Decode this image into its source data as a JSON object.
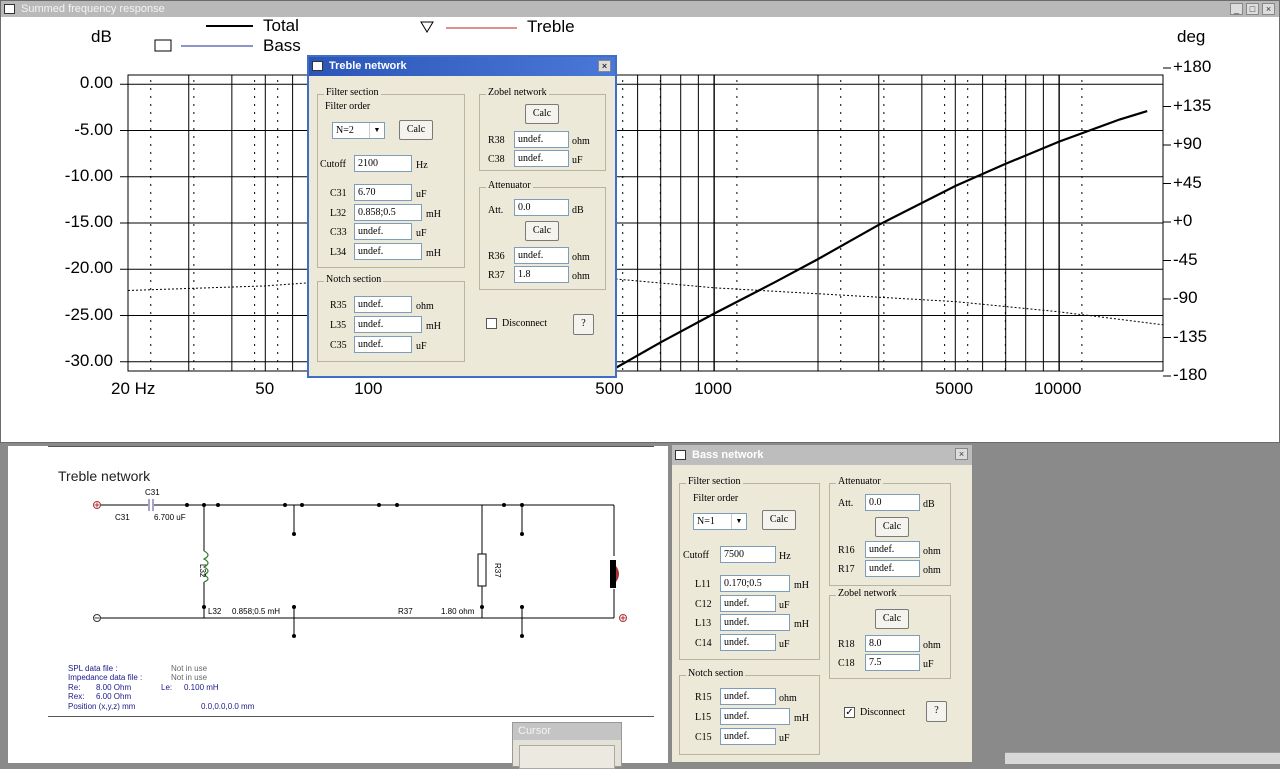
{
  "freq_window": {
    "title": "Summed frequency response",
    "legend": {
      "total": "Total",
      "bass": "Bass",
      "treble": "Treble"
    },
    "y_left_unit": "dB",
    "y_right_unit": "deg",
    "y_left_ticks": [
      "0.00",
      "-5.00",
      "-10.00",
      "-15.00",
      "-20.00",
      "-25.00",
      "-30.00"
    ],
    "y_right_ticks": [
      "+180",
      "+135",
      "+90",
      "+45",
      "+0",
      "-45",
      "-90",
      "-135",
      "-180"
    ],
    "x_ticks": [
      "20 Hz",
      "50",
      "100",
      "500",
      "1000",
      "5000",
      "10000"
    ]
  },
  "chart_data": {
    "type": "line",
    "title": "Summed frequency response",
    "xlabel": "",
    "ylabel": "dB",
    "y2label": "deg",
    "x_scale": "log",
    "xlim": [
      20,
      20000
    ],
    "ylim": [
      -31,
      1
    ],
    "y2lim": [
      -180,
      180
    ],
    "grid": true,
    "legend_position": "top",
    "series": [
      {
        "name": "Total",
        "style": "solid",
        "color": "#000000",
        "x": [
          500,
          700,
          1000,
          1500,
          2000,
          3000,
          5000,
          7000,
          10000,
          15000,
          18000
        ],
        "y": [
          -31.0,
          -27.9,
          -24.8,
          -21.4,
          -18.9,
          -15.2,
          -11.0,
          -8.6,
          -6.2,
          -3.8,
          -2.9
        ]
      },
      {
        "name": "Treble",
        "style": "dotted",
        "color": "#000000",
        "x": [
          20,
          50,
          100,
          500,
          1000,
          5000,
          10000,
          20000
        ],
        "y": [
          -22.3,
          -21.8,
          -21.0,
          -21.0,
          -22.0,
          -23.5,
          -24.6,
          -26.0
        ]
      }
    ]
  },
  "treble_dialog": {
    "title": "Treble network",
    "filter_section": "Filter section",
    "filter_order_label": "Filter order",
    "filter_order_value": "N=2",
    "calc": "Calc",
    "cutoff_label": "Cutoff",
    "cutoff_value": "2100",
    "cutoff_unit": "Hz",
    "c31_label": "C31",
    "c31_value": "6.70",
    "c31_unit": "uF",
    "l32_label": "L32",
    "l32_value": "0.858;0.5",
    "l32_unit": "mH",
    "c33_label": "C33",
    "c33_value": "undef.",
    "c33_unit": "uF",
    "l34_label": "L34",
    "l34_value": "undef.",
    "l34_unit": "mH",
    "notch_section": "Notch section",
    "r35_label": "R35",
    "r35_value": "undef.",
    "r35_unit": "ohm",
    "l35_label": "L35",
    "l35_value": "undef.",
    "l35_unit": "mH",
    "c35_label": "C35",
    "c35_value": "undef.",
    "c35_unit": "uF",
    "zobel_section": "Zobel network",
    "r38_label": "R38",
    "r38_value": "undef.",
    "r38_unit": "ohm",
    "c38_label": "C38",
    "c38_value": "undef.",
    "c38_unit": "uF",
    "att_section": "Attenuator",
    "att_label": "Att.",
    "att_value": "0.0",
    "att_unit": "dB",
    "r36_label": "R36",
    "r36_value": "undef.",
    "r36_unit": "ohm",
    "r37_label": "R37",
    "r37_value": "1.8",
    "r37_unit": "ohm",
    "disconnect": "Disconnect",
    "help": "?"
  },
  "bass_dialog": {
    "title": "Bass network",
    "filter_section": "Filter section",
    "filter_order_label": "Filter order",
    "filter_order_value": "N=1",
    "calc": "Calc",
    "cutoff_label": "Cutoff",
    "cutoff_value": "7500",
    "cutoff_unit": "Hz",
    "l11_label": "L11",
    "l11_value": "0.170;0.5",
    "l11_unit": "mH",
    "c12_label": "C12",
    "c12_value": "undef.",
    "c12_unit": "uF",
    "l13_label": "L13",
    "l13_value": "undef.",
    "l13_unit": "mH",
    "c14_label": "C14",
    "c14_value": "undef.",
    "c14_unit": "uF",
    "notch_section": "Notch section",
    "r15_label": "R15",
    "r15_value": "undef.",
    "r15_unit": "ohm",
    "l15_label": "L15",
    "l15_value": "undef.",
    "l15_unit": "mH",
    "c15_label": "C15",
    "c15_value": "undef.",
    "c15_unit": "uF",
    "att_section": "Attenuator",
    "att_label": "Att.",
    "att_value": "0.0",
    "att_unit": "dB",
    "r16_label": "R16",
    "r16_value": "undef.",
    "r16_unit": "ohm",
    "r17_label": "R17",
    "r17_value": "undef.",
    "r17_unit": "ohm",
    "zobel_section": "Zobel network",
    "r18_label": "R18",
    "r18_value": "8.0",
    "r18_unit": "ohm",
    "c18_label": "C18",
    "c18_value": "7.5",
    "c18_unit": "uF",
    "disconnect": "Disconnect",
    "disconnect_checked": "✓",
    "help": "?"
  },
  "schematic": {
    "title": "Treble network",
    "c31_top": "C31",
    "c31_left": "C31",
    "c31_value": "6.700 uF",
    "l32_coil": "L32",
    "l32_label": "L32",
    "l32_value": "0.858;0.5 mH",
    "r37_label": "R37",
    "r37_value": "1.80 ohm",
    "r37_res": "R37",
    "info": {
      "spl_label": "SPL data file :",
      "spl_value": "Not in use",
      "imp_label": "Impedance data file :",
      "imp_value": "Not in use",
      "re_label": "Re:",
      "re_value": "8.00 Ohm",
      "le_label": "Le:",
      "le_value": "0.100 mH",
      "rex_label": "Rex:",
      "rex_value": "6.00 Ohm",
      "pos_label": "Position (x,y,z) mm",
      "pos_value": "0.0,0.0,0.0 mm"
    }
  },
  "cursor_window": {
    "title": "Cursor"
  }
}
